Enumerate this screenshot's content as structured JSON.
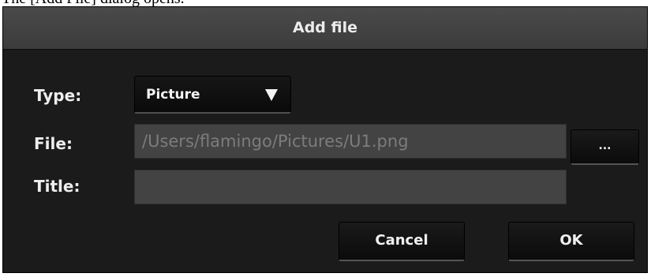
{
  "caption": "The [Add File] dialog opens.",
  "dialog": {
    "title": "Add file",
    "type_label": "Type:",
    "type_value": "Picture",
    "file_label": "File:",
    "file_value": "/Users/flamingo/Pictures/U1.png",
    "browse_label": "...",
    "title_label": "Title:",
    "title_value": "",
    "cancel_label": "Cancel",
    "ok_label": "OK"
  },
  "colors": {
    "dialog_background": "#1b1b1b",
    "titlebar_background": "#424242",
    "field_background": "#434343",
    "field_text": "#7c7c7c",
    "label_text": "#eeeeee"
  },
  "icons": {
    "dropdown": "chevron-down-icon"
  }
}
